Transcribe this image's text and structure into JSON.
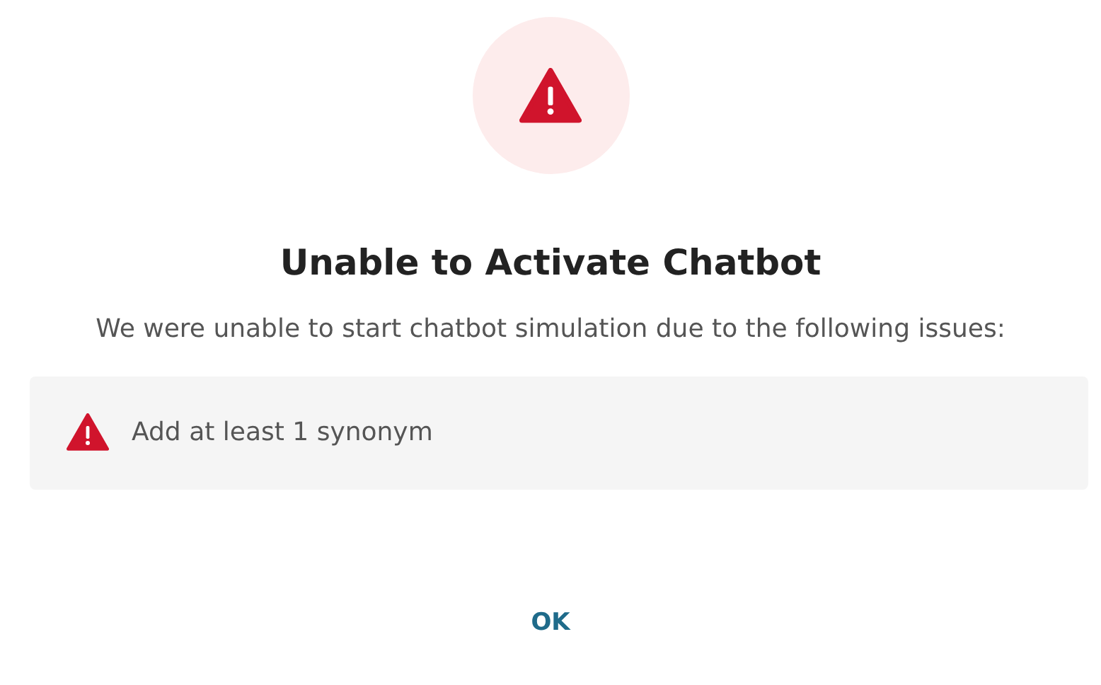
{
  "dialog": {
    "title": "Unable to Activate Chatbot",
    "message": "We were unable to start chatbot simulation due to the following issues:",
    "issues": [
      {
        "text": "Add at least 1 synonym"
      }
    ],
    "buttons": [
      "OK"
    ]
  }
}
